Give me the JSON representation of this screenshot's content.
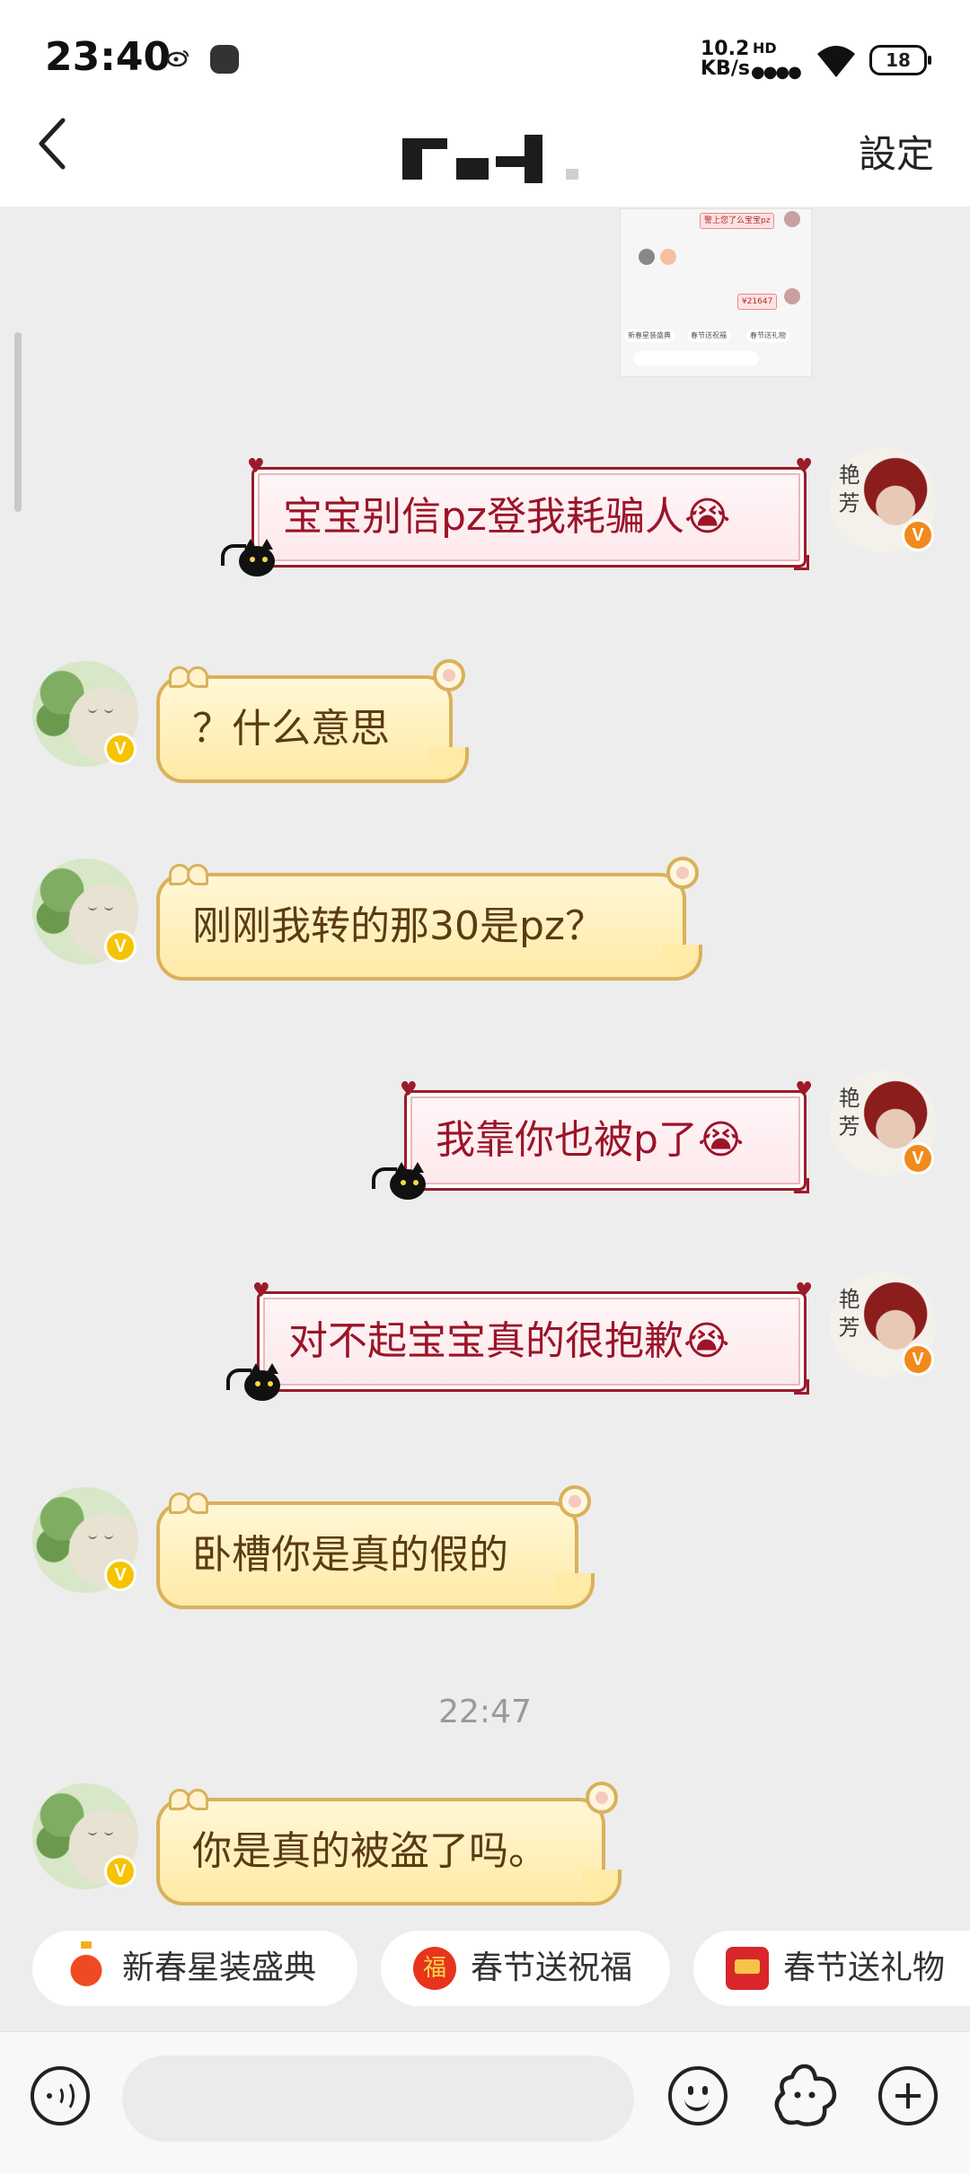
{
  "status_bar": {
    "time": "23:40",
    "network_speed": "10.2\nKB/s",
    "network_type": "HD",
    "signal": "●●●●",
    "battery": "18",
    "icons": [
      "weibo-icon",
      "message-notification-icon",
      "signal-icon",
      "wifi-icon",
      "battery-icon"
    ]
  },
  "header": {
    "back_icon": "chevron-left-icon",
    "title_pixelated": true,
    "settings_label": "設定"
  },
  "screenshot_thumbnail": {
    "lines": [
      "警上您了么宝宝pz",
      "¥21647"
    ],
    "pills": [
      "新春星装盛典",
      "春节送祝福",
      "春节送礼物"
    ]
  },
  "messages": [
    {
      "direction": "out",
      "text": "宝宝别信pz登我耗骗人😭",
      "avatar": "person-avatar",
      "badge": "V"
    },
    {
      "direction": "in",
      "text": "？什么意思",
      "avatar": "sprout-avatar",
      "badge": "V"
    },
    {
      "direction": "in",
      "text": "刚刚我转的那30是pz？",
      "avatar": "sprout-avatar",
      "badge": "V"
    },
    {
      "direction": "out",
      "text": "我靠你也被p了😭",
      "avatar": "person-avatar",
      "badge": "V"
    },
    {
      "direction": "out",
      "text": "对不起宝宝真的很抱歉😭",
      "avatar": "person-avatar",
      "badge": "V"
    },
    {
      "direction": "in",
      "text": "卧槽你是真的假的",
      "avatar": "sprout-avatar",
      "badge": "V"
    },
    {
      "direction": "in",
      "text": "你是真的被盗了吗。",
      "avatar": "sprout-avatar",
      "badge": "V"
    }
  ],
  "timestamp": "22:47",
  "quick_actions": [
    {
      "label": "新春星装盛典",
      "icon": "lantern-icon"
    },
    {
      "label": "春节送祝福",
      "icon": "fu-icon",
      "glyph": "福"
    },
    {
      "label": "春节送礼物",
      "icon": "gift-icon"
    }
  ],
  "input_bar": {
    "placeholder": "",
    "icons": [
      "voice-icon",
      "emoji-icon",
      "sticker-icon",
      "plus-icon"
    ]
  },
  "colors": {
    "background": "#ededed",
    "outgoing_text": "#9b1428",
    "outgoing_border": "#9b1b2a",
    "incoming_text": "#5b3b12",
    "incoming_fill": "#ffeaa6",
    "verified_yellow": "#f5c400",
    "verified_orange": "#f18a1c"
  }
}
